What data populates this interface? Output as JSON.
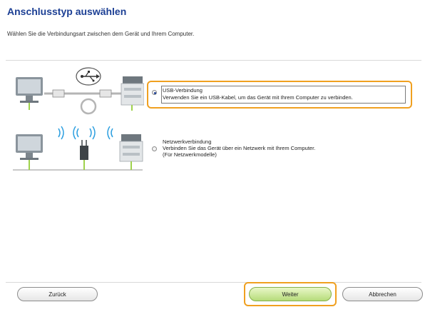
{
  "page": {
    "title": "Anschlusstyp auswählen",
    "subtitle": "Wählen Sie die Verbindungsart zwischen dem Gerät und Ihrem Computer."
  },
  "options": [
    {
      "id": "usb",
      "title": "USB-Verbindung",
      "description": "Verwenden Sie ein USB-Kabel, um das Gerät mit Ihrem Computer zu verbinden.",
      "selected": true
    },
    {
      "id": "network",
      "title": "Netzwerkverbindung",
      "description": "Verbinden Sie das Gerät über ein Netzwerk mit Ihrem Computer.",
      "note": "(Für Netzwerkmodelle)",
      "selected": false
    }
  ],
  "buttons": {
    "back": "Zurück",
    "next": "Weiter",
    "cancel": "Abbrechen"
  },
  "colors": {
    "title": "#1c3f94",
    "highlight": "#f0a020",
    "primary_button": "#b6dc7a"
  }
}
